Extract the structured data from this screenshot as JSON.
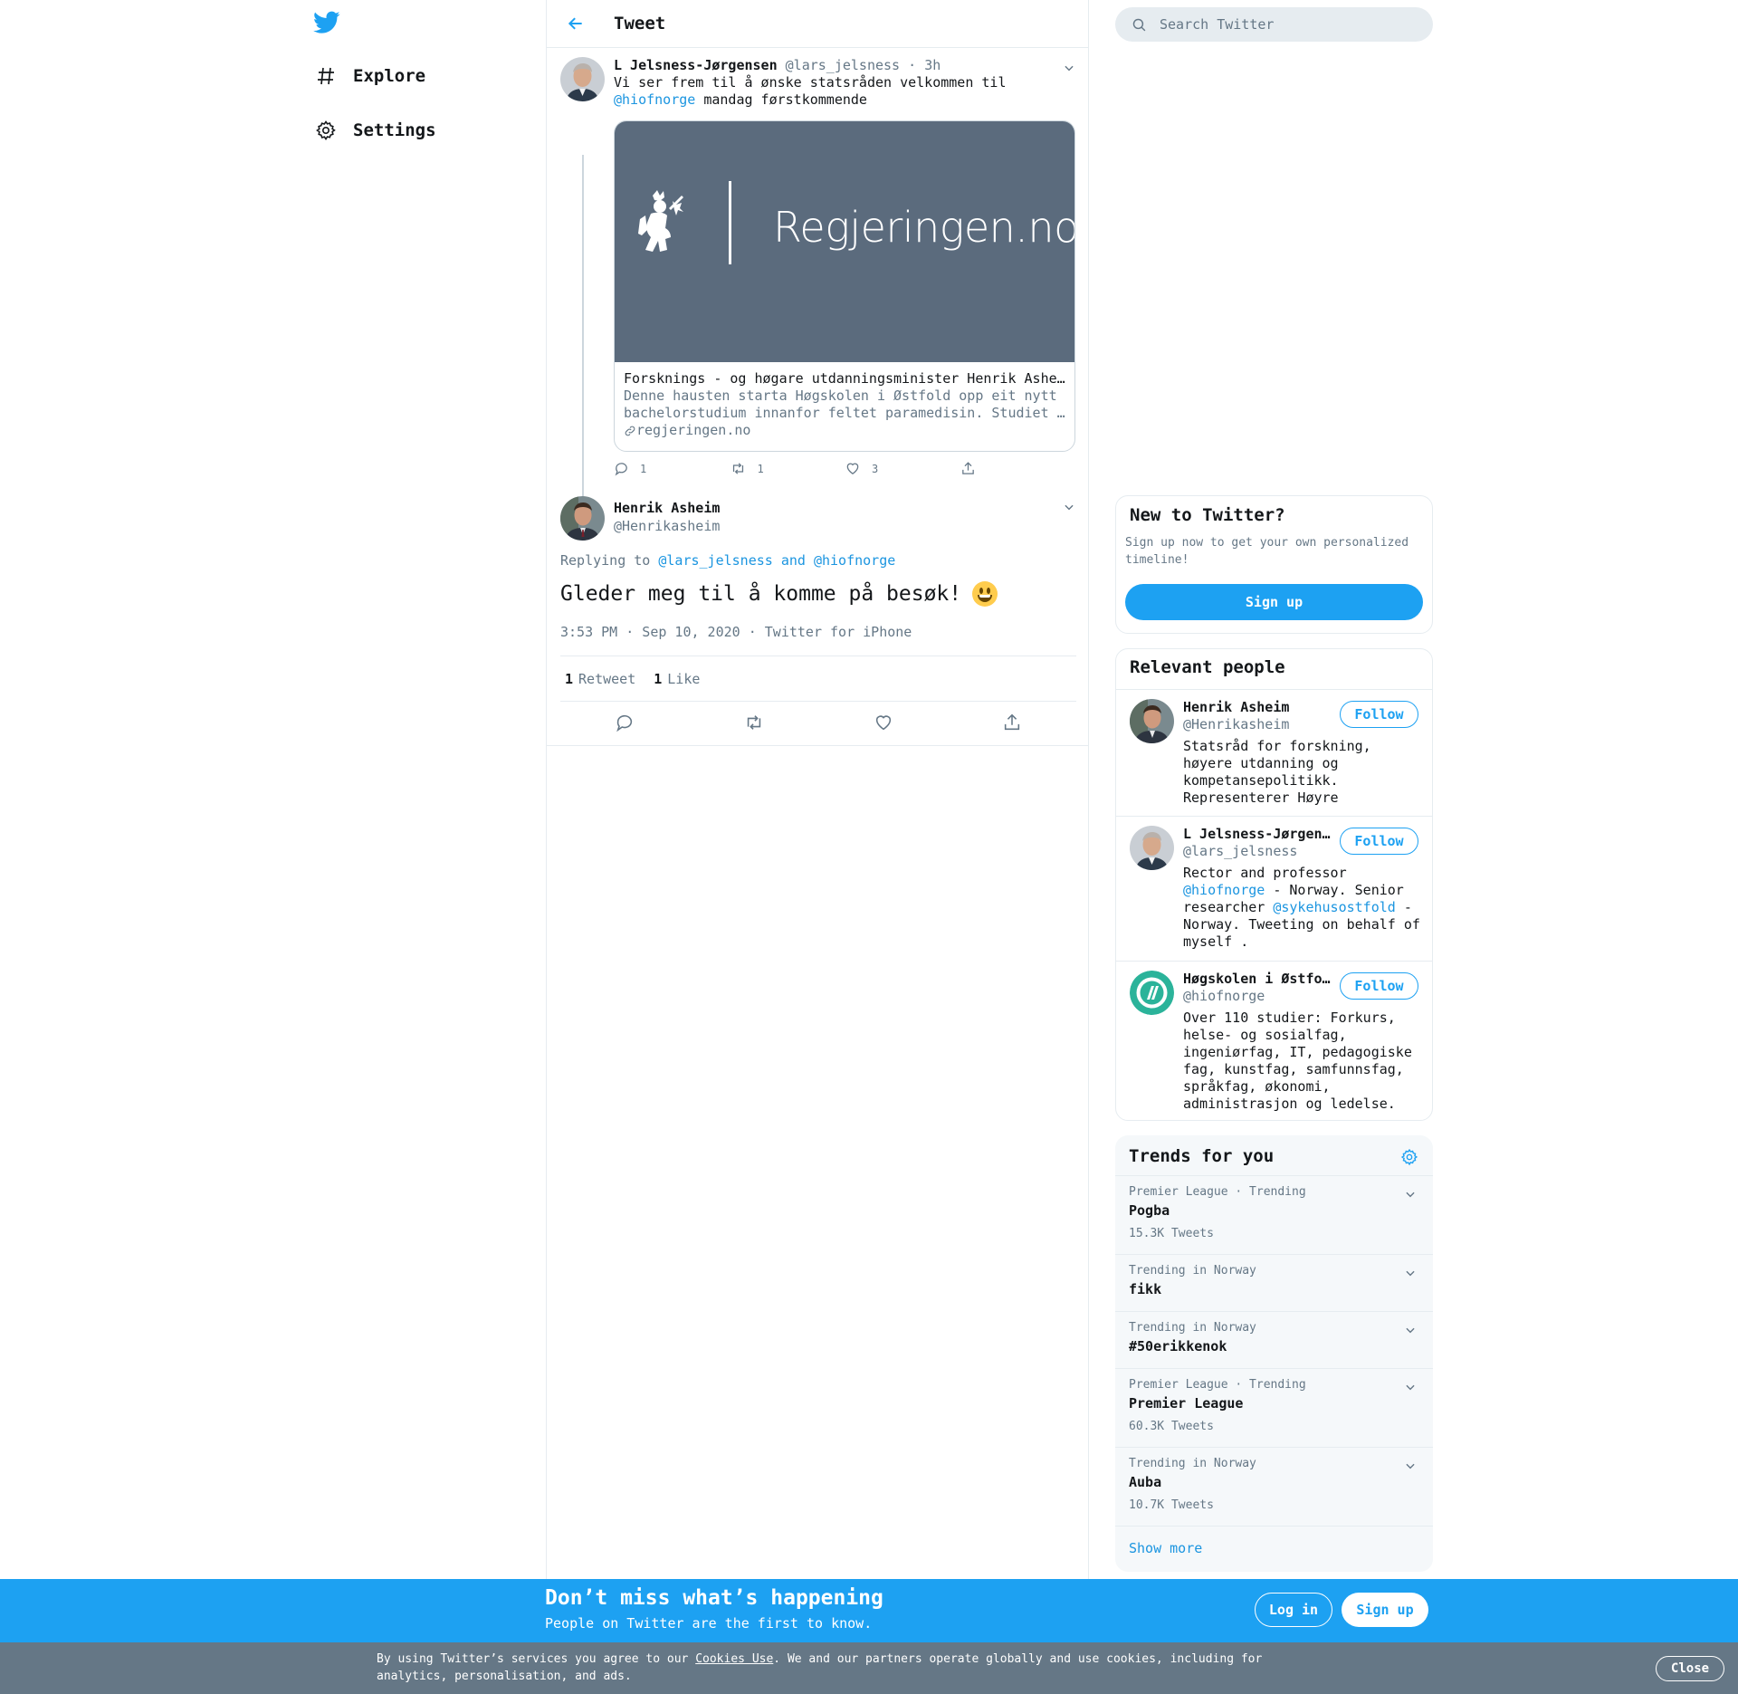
{
  "nav": {
    "items": [
      {
        "label": "Explore",
        "icon": "hashtag-icon"
      },
      {
        "label": "Settings",
        "icon": "gear-icon"
      }
    ]
  },
  "header": {
    "title": "Tweet"
  },
  "tweet1": {
    "name": "L Jelsness-Jørgensen",
    "handle": "@lars_jelsness",
    "time": "3h",
    "text_a": "Vi ser frem til å ønske statsråden velkommen til",
    "mention": "@hiofnorge",
    "text_b": "mandag førstkommende",
    "card": {
      "image_text": "Regjeringen.no",
      "title": "Forsknings - og høgare utdanningsminister Henrik Asheim",
      "desc_1": "Denne hausten starta Høgskolen i Østfold opp eit nytt",
      "desc_2": "bachelorstudium innanfor feltet paramedisin. Studiet har",
      "link": "regjeringen.no"
    },
    "replies": "1",
    "retweets": "1",
    "likes": "3"
  },
  "tweet2": {
    "name": "Henrik Asheim",
    "handle": "@Henrikasheim",
    "replying_prefix": "Replying to",
    "replying_to_1": "@lars_jelsness",
    "replying_and": "and",
    "replying_to_2": "@hiofnorge",
    "text": "Gleder meg til å komme på besøk!",
    "time": "3:53 PM · Sep 10, 2020",
    "source": "Twitter for iPhone",
    "retweet_count": "1",
    "retweet_label": "Retweet",
    "like_count": "1",
    "like_label": "Like"
  },
  "search": {
    "placeholder": "Search Twitter"
  },
  "new_to_twitter": {
    "title": "New to Twitter?",
    "desc": "Sign up now to get your own personalized timeline!",
    "button": "Sign up"
  },
  "relevant": {
    "title": "Relevant people",
    "people": [
      {
        "name": "Henrik Asheim",
        "handle": "@Henrikasheim",
        "follow": "Follow",
        "bio": "Statsråd for forskning, høyere utdanning og kompetansepolitikk. Representerer Høyre"
      },
      {
        "name": "L Jelsness-Jørgensen",
        "handle": "@lars_jelsness",
        "follow": "Follow",
        "bio_a": "Rector and professor",
        "bio_m1": "@hiofnorge",
        "bio_b": "- Norway. Senior researcher",
        "bio_m2": "@sykehusostfold",
        "bio_c": "- Norway. Tweeting on behalf of myself ."
      },
      {
        "name": "Høgskolen i Østfold",
        "handle": "@hiofnorge",
        "follow": "Follow",
        "bio": "Over 110 studier: Forkurs, helse- og sosialfag, ingeniørfag, IT, pedagogiske fag, kunstfag, samfunnsfag, språkfag, økonomi, administrasjon og ledelse."
      }
    ]
  },
  "trends": {
    "title": "Trends for you",
    "items": [
      {
        "category": "Premier League · Trending",
        "name": "Pogba",
        "count": "15.3K Tweets"
      },
      {
        "category": "Trending in Norway",
        "name": "fikk",
        "count": ""
      },
      {
        "category": "Trending in Norway",
        "name": "#50erikkenok",
        "count": ""
      },
      {
        "category": "Premier League · Trending",
        "name": "Premier League",
        "count": "60.3K Tweets"
      },
      {
        "category": "Trending in Norway",
        "name": "Auba",
        "count": "10.7K Tweets"
      }
    ],
    "show_more": "Show more"
  },
  "banner": {
    "headline": "Don’t miss what’s happening",
    "sub": "People on Twitter are the first to know.",
    "login": "Log in",
    "signup": "Sign up"
  },
  "cookie": {
    "text_a": "By using Twitter’s services you agree to our",
    "link": "Cookies Use",
    "text_b": ". We and our partners operate globally and use cookies, including for analytics, personalisation, and ads.",
    "close": "Close"
  },
  "colors": {
    "accent": "#1da1f2",
    "link": "#1b95e0",
    "muted": "#657786",
    "border": "#e6ecf0",
    "cookie_bg": "#657786",
    "card_bg": "#5b6b7d"
  }
}
